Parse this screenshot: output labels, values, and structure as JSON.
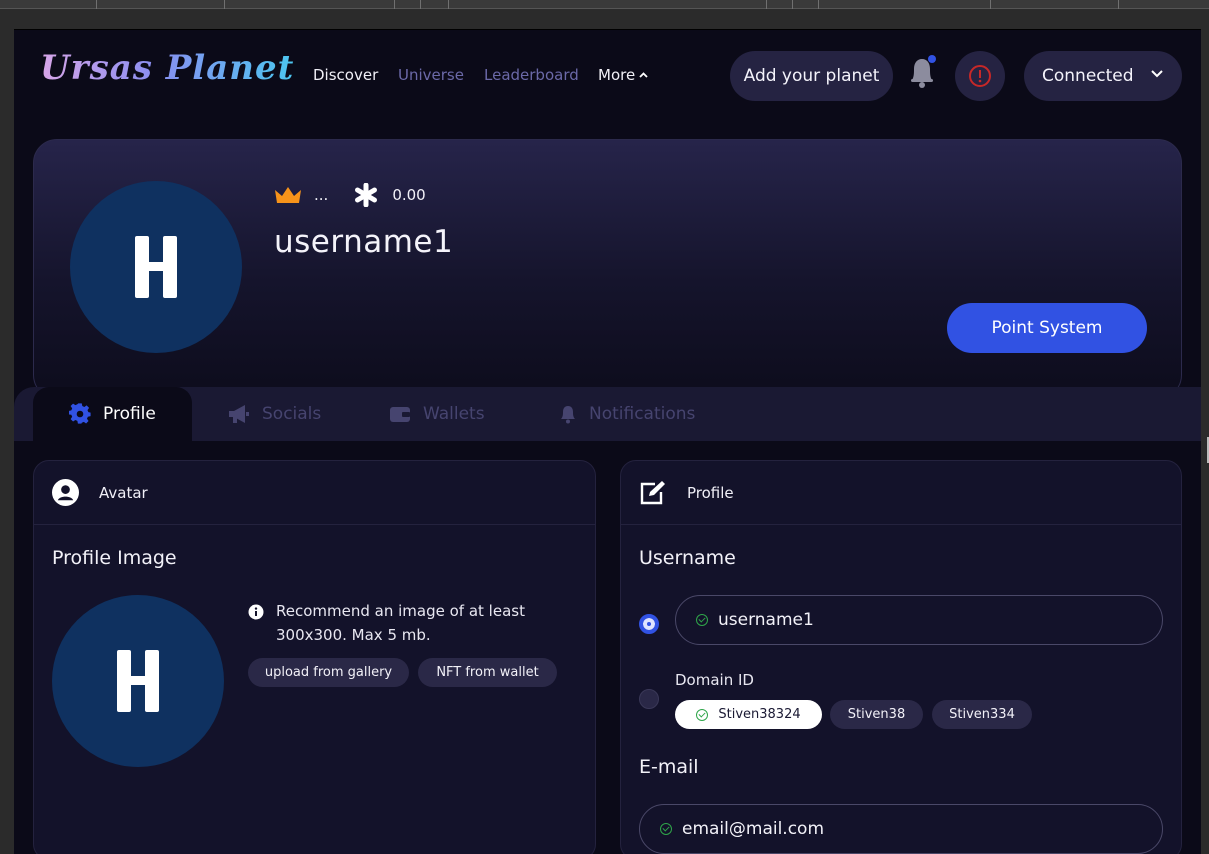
{
  "app": {
    "logo": "Ursas Planet"
  },
  "nav": {
    "discover": "Discover",
    "universe": "Universe",
    "leaderboard": "Leaderboard",
    "more": "More"
  },
  "header": {
    "add_planet": "Add your planet",
    "connected": "Connected"
  },
  "hero": {
    "rank": "...",
    "points": "0.00",
    "username": "username1",
    "point_system": "Point System"
  },
  "tabs": [
    {
      "label": "Profile"
    },
    {
      "label": "Socials"
    },
    {
      "label": "Wallets"
    },
    {
      "label": "Notifications"
    }
  ],
  "avatar_card": {
    "title": "Avatar",
    "section_title": "Profile Image",
    "info": "Recommend an image of at least 300x300. Max 5 mb.",
    "upload_gallery": "upload from gallery",
    "nft_wallet": "NFT from wallet"
  },
  "profile_card": {
    "title": "Profile",
    "username_label": "Username",
    "username_value": "username1",
    "domain_label": "Domain ID",
    "domains": [
      "Stiven38324",
      "Stiven38",
      "Stiven334"
    ],
    "email_label": "E-mail",
    "email_value": "email@mail.com"
  },
  "colors": {
    "accent": "#3152e3",
    "avatar_bg": "#0f3160",
    "crown": "#f7931a",
    "alert": "#c62828",
    "check": "#2fa64a"
  }
}
